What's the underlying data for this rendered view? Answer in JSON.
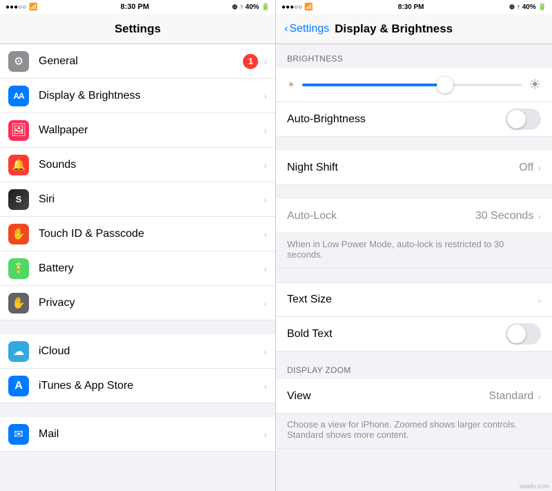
{
  "left": {
    "status": {
      "signal": "●●●○○",
      "wifi": "WiFi",
      "time": "8:30 PM",
      "location": "◉",
      "arrow": "↑",
      "battery_pct": "40%",
      "battery": "🔋"
    },
    "title": "Settings",
    "items": [
      {
        "id": "general",
        "label": "General",
        "icon": "⚙",
        "icon_class": "icon-gray",
        "badge": "1",
        "chevron": true
      },
      {
        "id": "display",
        "label": "Display & Brightness",
        "icon": "AA",
        "icon_class": "icon-blue icon-aa",
        "badge": "",
        "chevron": true
      },
      {
        "id": "wallpaper",
        "label": "Wallpaper",
        "icon": "❋",
        "icon_class": "icon-pink",
        "badge": "",
        "chevron": true
      },
      {
        "id": "sounds",
        "label": "Sounds",
        "icon": "🔔",
        "icon_class": "icon-red",
        "badge": "",
        "chevron": true
      },
      {
        "id": "siri",
        "label": "Siri",
        "icon": "S",
        "icon_class": "siri-icon",
        "badge": "",
        "chevron": true
      },
      {
        "id": "touchid",
        "label": "Touch ID & Passcode",
        "icon": "✋",
        "icon_class": "icon-red",
        "badge": "",
        "chevron": true
      },
      {
        "id": "battery",
        "label": "Battery",
        "icon": "▣",
        "icon_class": "icon-green",
        "badge": "",
        "chevron": true
      },
      {
        "id": "privacy",
        "label": "Privacy",
        "icon": "✋",
        "icon_class": "icon-darkgray",
        "badge": "",
        "chevron": true
      }
    ],
    "items2": [
      {
        "id": "icloud",
        "label": "iCloud",
        "icon": "☁",
        "icon_class": "icon-blue2",
        "badge": "",
        "chevron": true
      },
      {
        "id": "itunes",
        "label": "iTunes & App Store",
        "icon": "A",
        "icon_class": "icon-blue",
        "badge": "",
        "chevron": true
      }
    ],
    "items3": [
      {
        "id": "mail",
        "label": "Mail",
        "icon": "✉",
        "icon_class": "icon-blue",
        "badge": "",
        "chevron": true
      }
    ]
  },
  "right": {
    "status": {
      "signal": "●●●○○",
      "wifi": "WiFi",
      "time": "8:30 PM",
      "location": "◉",
      "arrow": "↑",
      "battery_pct": "40%"
    },
    "back_label": "Settings",
    "title": "Display & Brightness",
    "brightness_section": "BRIGHTNESS",
    "slider_value": 65,
    "auto_brightness_label": "Auto-Brightness",
    "auto_brightness_on": false,
    "night_shift_label": "Night Shift",
    "night_shift_value": "Off",
    "auto_lock_label": "Auto-Lock",
    "auto_lock_value": "30 Seconds",
    "auto_lock_note": "When in Low Power Mode, auto-lock is restricted to 30 seconds.",
    "text_size_label": "Text Size",
    "bold_text_label": "Bold Text",
    "bold_text_on": false,
    "display_zoom_section": "DISPLAY ZOOM",
    "view_label": "View",
    "view_value": "Standard",
    "view_note": "Choose a view for iPhone. Zoomed shows larger controls. Standard shows more content.",
    "watermark": "wiadn.com"
  }
}
